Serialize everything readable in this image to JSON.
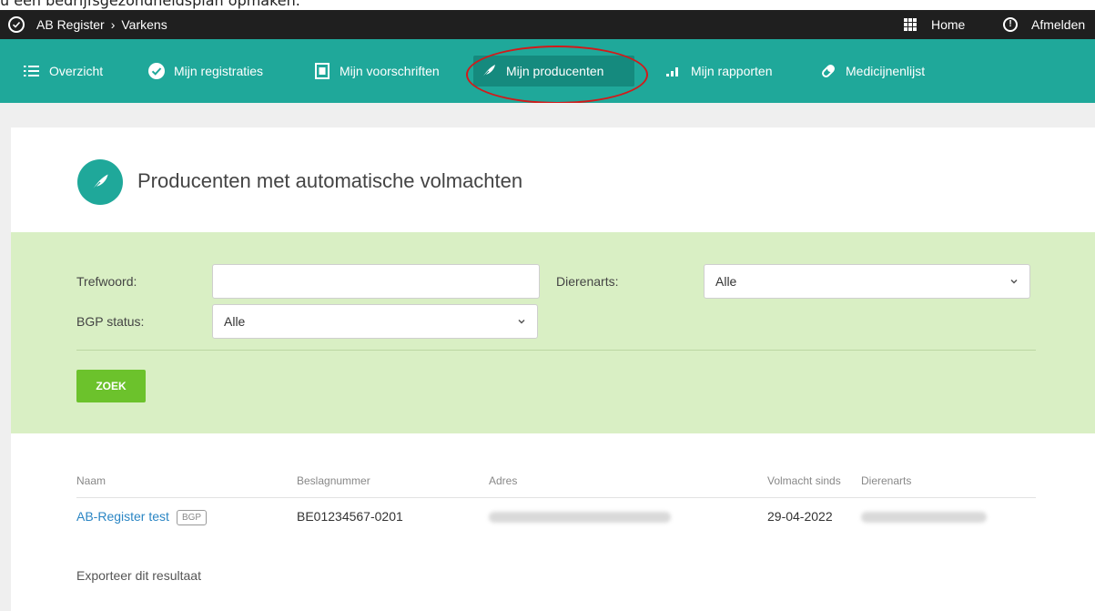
{
  "caption": "u een bedrijfsgezondheidsplan opmaken.",
  "topbar": {
    "app": "AB Register",
    "section": "Varkens",
    "separator": "›",
    "home": "Home",
    "logout": "Afmelden"
  },
  "nav": {
    "items": [
      {
        "label": "Overzicht",
        "icon": "list-icon"
      },
      {
        "label": "Mijn registraties",
        "icon": "check-circle-icon"
      },
      {
        "label": "Mijn voorschriften",
        "icon": "document-icon"
      },
      {
        "label": "Mijn producenten",
        "icon": "feather-icon",
        "active": true
      },
      {
        "label": "Mijn rapporten",
        "icon": "bar-chart-icon"
      },
      {
        "label": "Medicijnenlijst",
        "icon": "pill-icon"
      }
    ]
  },
  "page": {
    "title": "Producenten met automatische volmachten"
  },
  "filters": {
    "trefwoord_label": "Trefwoord:",
    "trefwoord_value": "",
    "dierenarts_label": "Dierenarts:",
    "dierenarts_value": "Alle",
    "bgp_label": "BGP status:",
    "bgp_value": "Alle",
    "search_button": "ZOEK"
  },
  "table": {
    "headers": {
      "naam": "Naam",
      "beslagnummer": "Beslagnummer",
      "adres": "Adres",
      "volmacht": "Volmacht sinds",
      "dierenarts": "Dierenarts"
    },
    "rows": [
      {
        "naam": "AB-Register test",
        "badge": "BGP",
        "beslagnummer": "BE01234567-0201",
        "volmacht": "29-04-2022"
      }
    ]
  },
  "export_label": "Exporteer dit resultaat",
  "colors": {
    "topbar": "#1f1f1f",
    "nav": "#1fa89a",
    "nav_active": "#158a7e",
    "filter_bg": "#d9efc4",
    "button": "#6cc22c",
    "link": "#2b86c4",
    "annotation": "#d21a1a"
  }
}
